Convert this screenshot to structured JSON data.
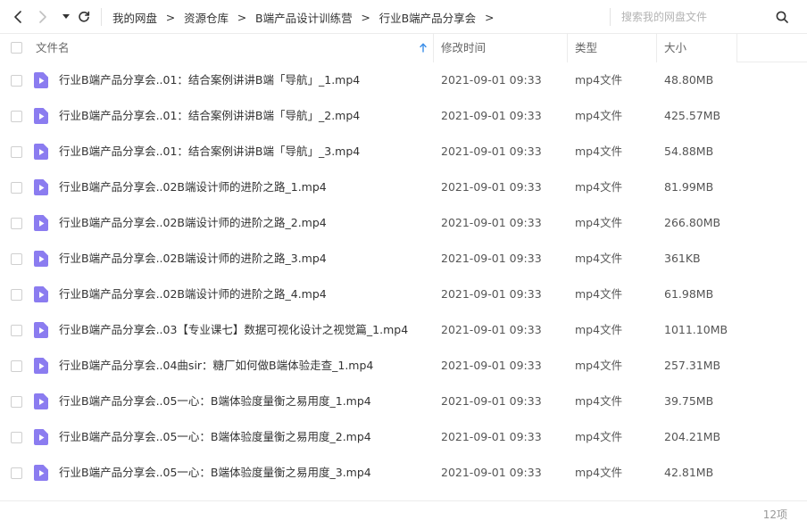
{
  "nav": {
    "back_icon": "chevron-left-icon",
    "forward_icon": "chevron-right-icon",
    "dropdown_icon": "caret-down-icon",
    "refresh_icon": "refresh-icon"
  },
  "breadcrumb": {
    "items": [
      "我的网盘",
      "资源仓库",
      "B端产品设计训练营",
      "行业B端产品分享会"
    ],
    "separator": ">"
  },
  "search": {
    "placeholder": "搜索我的网盘文件",
    "value": "",
    "icon": "search-icon"
  },
  "table": {
    "headers": {
      "name": "文件名",
      "modified": "修改时间",
      "type": "类型",
      "size": "大小"
    },
    "sort_icon": "sort-arrow-up-icon",
    "rows": [
      {
        "name": "行业B端产品分享会..01：结合案例讲讲B端「导航」_1.mp4",
        "modified": "2021-09-01 09:33",
        "type": "mp4文件",
        "size": "48.80MB"
      },
      {
        "name": "行业B端产品分享会..01：结合案例讲讲B端「导航」_2.mp4",
        "modified": "2021-09-01 09:33",
        "type": "mp4文件",
        "size": "425.57MB"
      },
      {
        "name": "行业B端产品分享会..01：结合案例讲讲B端「导航」_3.mp4",
        "modified": "2021-09-01 09:33",
        "type": "mp4文件",
        "size": "54.88MB"
      },
      {
        "name": "行业B端产品分享会..02B端设计师的进阶之路_1.mp4",
        "modified": "2021-09-01 09:33",
        "type": "mp4文件",
        "size": "81.99MB"
      },
      {
        "name": "行业B端产品分享会..02B端设计师的进阶之路_2.mp4",
        "modified": "2021-09-01 09:33",
        "type": "mp4文件",
        "size": "266.80MB"
      },
      {
        "name": "行业B端产品分享会..02B端设计师的进阶之路_3.mp4",
        "modified": "2021-09-01 09:33",
        "type": "mp4文件",
        "size": "361KB"
      },
      {
        "name": "行业B端产品分享会..02B端设计师的进阶之路_4.mp4",
        "modified": "2021-09-01 09:33",
        "type": "mp4文件",
        "size": "61.98MB"
      },
      {
        "name": "行业B端产品分享会..03【专业课七】数据可视化设计之视觉篇_1.mp4",
        "modified": "2021-09-01 09:33",
        "type": "mp4文件",
        "size": "1011.10MB"
      },
      {
        "name": "行业B端产品分享会..04曲sir：糖厂如何做B端体验走查_1.mp4",
        "modified": "2021-09-01 09:33",
        "type": "mp4文件",
        "size": "257.31MB"
      },
      {
        "name": "行业B端产品分享会..05一心：B端体验度量衡之易用度_1.mp4",
        "modified": "2021-09-01 09:33",
        "type": "mp4文件",
        "size": "39.75MB"
      },
      {
        "name": "行业B端产品分享会..05一心：B端体验度量衡之易用度_2.mp4",
        "modified": "2021-09-01 09:33",
        "type": "mp4文件",
        "size": "204.21MB"
      },
      {
        "name": "行业B端产品分享会..05一心：B端体验度量衡之易用度_3.mp4",
        "modified": "2021-09-01 09:33",
        "type": "mp4文件",
        "size": "42.81MB"
      }
    ]
  },
  "footer": {
    "count": "12项"
  },
  "colors": {
    "video_icon": "#8b7cf0",
    "sort_arrow": "#3b8ee8"
  }
}
